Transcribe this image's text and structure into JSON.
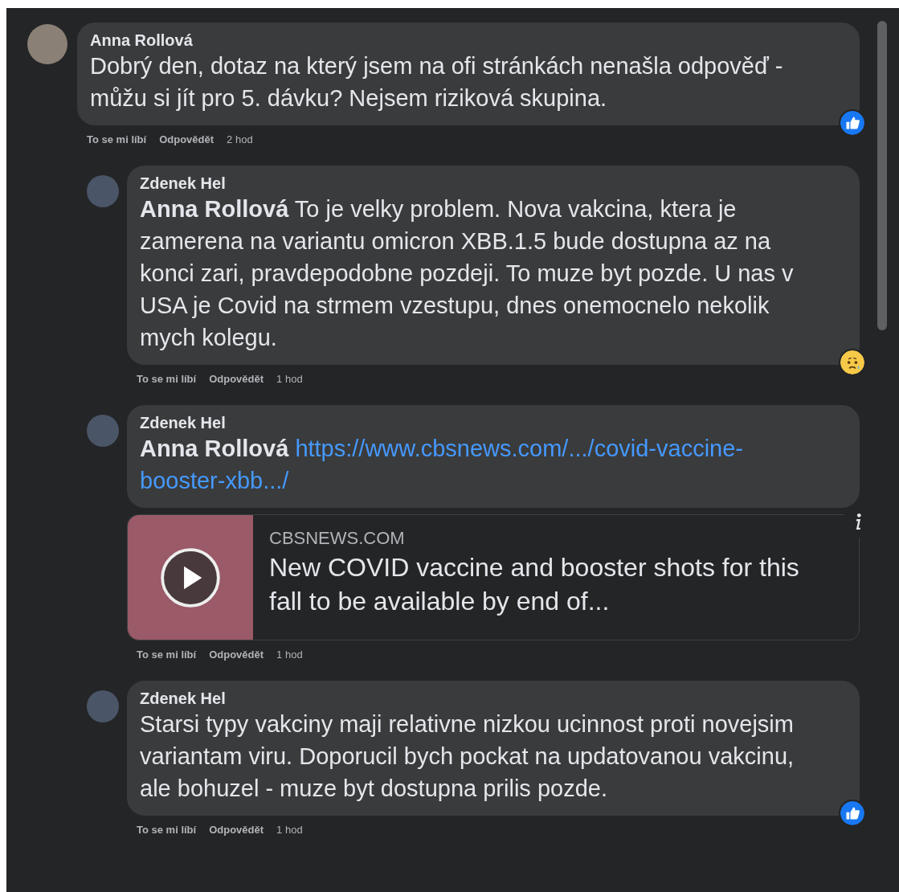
{
  "comments": [
    {
      "author": "Anna Rollová",
      "reply": false,
      "text": "Dobrý den, dotaz na který jsem na ofi stránkách nenašla odpověď - můžu si jít pro 5. dávku? Nejsem riziková skupina.",
      "actions": {
        "like": "To se mi líbí",
        "reply": "Odpovědět",
        "time": "2 hod"
      },
      "reaction": {
        "kind": "like"
      }
    },
    {
      "author": "Zdenek Hel",
      "reply": true,
      "mention": "Anna Rollová",
      "text": "To je velky problem. Nova vakcina, ktera je zamerena na variantu omicron XBB.1.5 bude dostupna az na konci zari, pravdepodobne pozdeji. To muze byt pozde. U nas v USA je Covid na strmem vzestupu, dnes onemocnelo nekolik mych kolegu.",
      "actions": {
        "like": "To se mi líbí",
        "reply": "Odpovědět",
        "time": "1 hod"
      },
      "reaction": {
        "kind": "sad"
      }
    },
    {
      "author": "Zdenek Hel",
      "reply": true,
      "mention": "Anna Rollová",
      "link": "https://www.cbsnews.com/.../covid-vaccine-booster-xbb.../",
      "preview": {
        "domain": "CBSNEWS.COM",
        "title": "New COVID vaccine and booster shots for this fall to be available by end of..."
      },
      "actions": {
        "like": "To se mi líbí",
        "reply": "Odpovědět",
        "time": "1 hod"
      }
    },
    {
      "author": "Zdenek Hel",
      "reply": true,
      "text": "Starsi typy vakciny maji relativne nizkou ucinnost proti novejsim variantam viru. Doporucil bych pockat na updatovanou vakcinu, ale bohuzel - muze byt dostupna prilis pozde.",
      "actions": {
        "like": "To se mi líbí",
        "reply": "Odpovědět",
        "time": "1 hod"
      },
      "reaction": {
        "kind": "like"
      }
    }
  ]
}
